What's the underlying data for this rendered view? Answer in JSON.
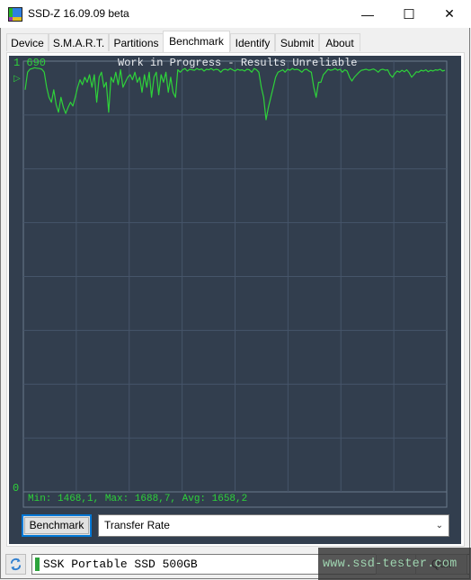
{
  "window": {
    "title": "SSD-Z 16.09.09 beta",
    "controls": {
      "minimize": "—",
      "maximize": "☐",
      "close": "✕"
    }
  },
  "tabs": [
    {
      "label": "Device"
    },
    {
      "label": "S.M.A.R.T."
    },
    {
      "label": "Partitions"
    },
    {
      "label": "Benchmark",
      "active": true
    },
    {
      "label": "Identify"
    },
    {
      "label": "Submit"
    },
    {
      "label": "About"
    }
  ],
  "chart_data": {
    "type": "line",
    "title": "Work in Progress - Results Unreliable",
    "ylim": [
      0,
      1690
    ],
    "y_tick_labels": {
      "max": "1 690",
      "min": "0"
    },
    "grid": true,
    "grid_cols": 8,
    "grid_rows": 8,
    "line_color": "#2ed23a",
    "background": "#323e4e",
    "series": [
      {
        "name": "Transfer Rate",
        "values": [
          1590,
          1660,
          1672,
          1675,
          1678,
          1676,
          1675,
          1672,
          1660,
          1600,
          1560,
          1540,
          1590,
          1530,
          1500,
          1560,
          1520,
          1495,
          1520,
          1540,
          1525,
          1560,
          1600,
          1630,
          1610,
          1640,
          1620,
          1650,
          1600,
          1650,
          1540,
          1640,
          1660,
          1600,
          1620,
          1500,
          1640,
          1620,
          1660,
          1610,
          1670,
          1600,
          1620,
          1640,
          1650,
          1630,
          1660,
          1620,
          1640,
          1580,
          1650,
          1600,
          1660,
          1560,
          1640,
          1660,
          1570,
          1650,
          1620,
          1660,
          1580,
          1640,
          1580,
          1560,
          1670,
          1660,
          1670,
          1675,
          1665,
          1672,
          1670,
          1668,
          1675,
          1670,
          1673,
          1665,
          1672,
          1670,
          1675,
          1668,
          1672,
          1670,
          1660,
          1670,
          1672,
          1668,
          1675,
          1670,
          1665,
          1672,
          1668,
          1670,
          1665,
          1672,
          1670,
          1660,
          1675,
          1670,
          1660,
          1600,
          1560,
          1470,
          1520,
          1560,
          1600,
          1640,
          1660,
          1665,
          1670,
          1660,
          1672,
          1668,
          1675,
          1670,
          1672,
          1668,
          1660,
          1670,
          1672,
          1665,
          1660,
          1600,
          1560,
          1620,
          1620,
          1650,
          1660,
          1672,
          1668,
          1670,
          1675,
          1668,
          1672,
          1660,
          1670,
          1665,
          1640,
          1625,
          1640,
          1650,
          1660,
          1668,
          1670,
          1672,
          1668,
          1670,
          1673,
          1668,
          1660,
          1670,
          1672,
          1668,
          1670,
          1650,
          1640,
          1655,
          1665,
          1660,
          1668,
          1662,
          1670,
          1658,
          1640,
          1650,
          1662,
          1660,
          1668,
          1665,
          1670,
          1662,
          1668,
          1665,
          1670,
          1668,
          1672,
          1665,
          1668
        ]
      }
    ],
    "stats": "Min: 1468,1, Max: 1688,7, Avg: 1658,2"
  },
  "controls": {
    "benchmark_button": "Benchmark",
    "metric_select": {
      "value": "Transfer Rate"
    }
  },
  "statusbar": {
    "drive_name": "SSK Portable SSD 500GB",
    "drive_status_color": "#2ca33c",
    "button_1_label": "?",
    "button_2_label": "Quit"
  },
  "watermark": "www.ssd-tester.com"
}
